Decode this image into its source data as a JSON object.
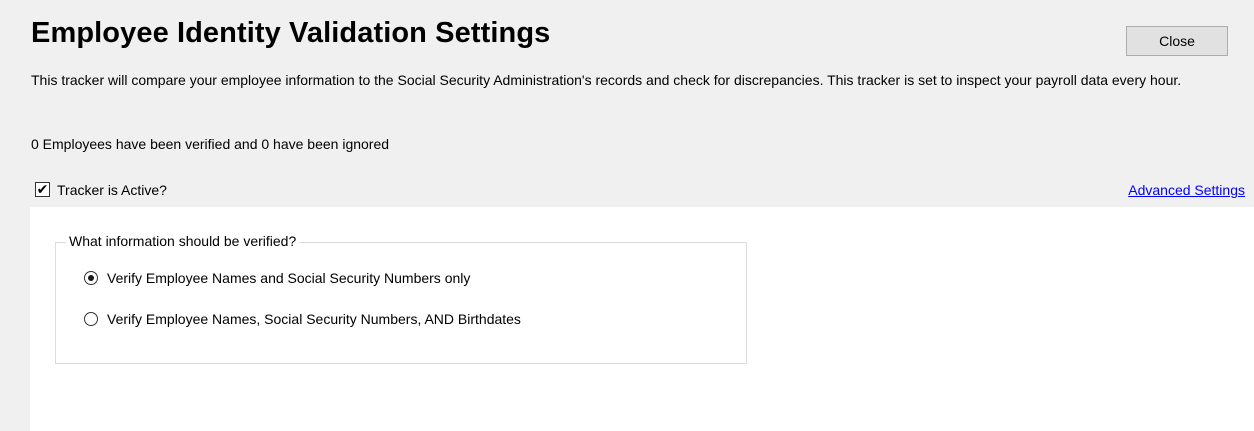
{
  "header": {
    "title": "Employee Identity Validation Settings",
    "close_label": "Close"
  },
  "description": "This tracker will compare your employee information to the Social Security Administration's records and check for discrepancies. This tracker is set to inspect your payroll data every hour.",
  "summary": "0 Employees have been verified and 0 have been ignored",
  "tracker": {
    "label": "Tracker is Active?",
    "checked": true
  },
  "advanced_settings_label": "Advanced Settings",
  "verification": {
    "legend": "What information should be verified?",
    "options": [
      {
        "label": "Verify Employee Names and Social Security Numbers only",
        "selected": true
      },
      {
        "label": "Verify Employee Names, Social Security Numbers, AND Birthdates",
        "selected": false
      }
    ]
  },
  "colors": {
    "top_panel_background": "#f0f0f0",
    "content_background": "#ffffff",
    "link": "#0000ff",
    "button_background": "#e1e1e1"
  },
  "icons": {
    "checkbox_checked": "checkmark-icon",
    "radio_selected": "radio-dot-icon"
  }
}
